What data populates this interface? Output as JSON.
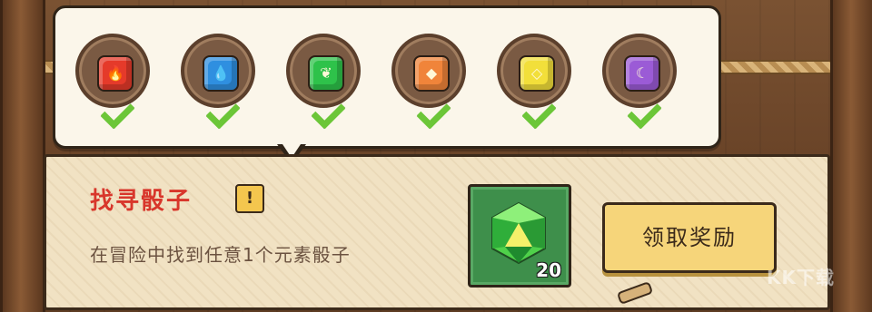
{
  "dice": [
    {
      "color": "#e53a2a",
      "element": "fire",
      "symbol": "🔥",
      "collected": true
    },
    {
      "color": "#2f8fe0",
      "element": "water",
      "symbol": "💧",
      "collected": true
    },
    {
      "color": "#2ec24a",
      "element": "wind",
      "symbol": "❦",
      "collected": true
    },
    {
      "color": "#f0843a",
      "element": "earth",
      "symbol": "◆",
      "collected": true
    },
    {
      "color": "#f2df3a",
      "element": "thunder",
      "symbol": "◇",
      "collected": true
    },
    {
      "color": "#9b5bd6",
      "element": "moon",
      "symbol": "☾",
      "collected": true
    }
  ],
  "task": {
    "title": "找寻骰子",
    "alert_symbol": "!",
    "description": "在冒险中找到任意1个元素骰子"
  },
  "reward": {
    "item": "green-gem",
    "count": "20",
    "color": "#3e8f4b"
  },
  "claim_button": {
    "label": "领取奖励"
  },
  "watermark": {
    "text": "KK下载"
  }
}
